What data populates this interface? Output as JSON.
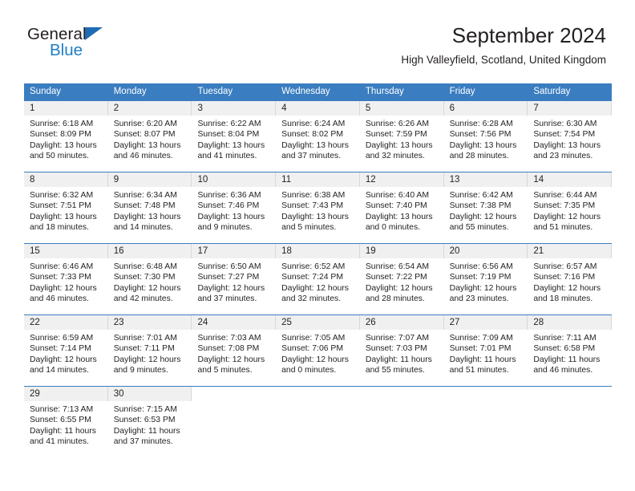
{
  "logo": {
    "word1": "General",
    "word2": "Blue",
    "triangle_color": "#1f6cb4",
    "blue_color": "#1f7ec4"
  },
  "header": {
    "title": "September 2024",
    "subtitle": "High Valleyfield, Scotland, United Kingdom"
  },
  "colors": {
    "header_bar": "#3a7dc0",
    "daynum_band": "#f0f0f0",
    "text": "#231f20"
  },
  "weekdays": [
    "Sunday",
    "Monday",
    "Tuesday",
    "Wednesday",
    "Thursday",
    "Friday",
    "Saturday"
  ],
  "labels": {
    "sunrise": "Sunrise:",
    "sunset": "Sunset:",
    "daylight": "Daylight:"
  },
  "weeks": [
    [
      {
        "day": "1",
        "sunrise": "Sunrise: 6:18 AM",
        "sunset": "Sunset: 8:09 PM",
        "daylight1": "Daylight: 13 hours",
        "daylight2": "and 50 minutes."
      },
      {
        "day": "2",
        "sunrise": "Sunrise: 6:20 AM",
        "sunset": "Sunset: 8:07 PM",
        "daylight1": "Daylight: 13 hours",
        "daylight2": "and 46 minutes."
      },
      {
        "day": "3",
        "sunrise": "Sunrise: 6:22 AM",
        "sunset": "Sunset: 8:04 PM",
        "daylight1": "Daylight: 13 hours",
        "daylight2": "and 41 minutes."
      },
      {
        "day": "4",
        "sunrise": "Sunrise: 6:24 AM",
        "sunset": "Sunset: 8:02 PM",
        "daylight1": "Daylight: 13 hours",
        "daylight2": "and 37 minutes."
      },
      {
        "day": "5",
        "sunrise": "Sunrise: 6:26 AM",
        "sunset": "Sunset: 7:59 PM",
        "daylight1": "Daylight: 13 hours",
        "daylight2": "and 32 minutes."
      },
      {
        "day": "6",
        "sunrise": "Sunrise: 6:28 AM",
        "sunset": "Sunset: 7:56 PM",
        "daylight1": "Daylight: 13 hours",
        "daylight2": "and 28 minutes."
      },
      {
        "day": "7",
        "sunrise": "Sunrise: 6:30 AM",
        "sunset": "Sunset: 7:54 PM",
        "daylight1": "Daylight: 13 hours",
        "daylight2": "and 23 minutes."
      }
    ],
    [
      {
        "day": "8",
        "sunrise": "Sunrise: 6:32 AM",
        "sunset": "Sunset: 7:51 PM",
        "daylight1": "Daylight: 13 hours",
        "daylight2": "and 18 minutes."
      },
      {
        "day": "9",
        "sunrise": "Sunrise: 6:34 AM",
        "sunset": "Sunset: 7:48 PM",
        "daylight1": "Daylight: 13 hours",
        "daylight2": "and 14 minutes."
      },
      {
        "day": "10",
        "sunrise": "Sunrise: 6:36 AM",
        "sunset": "Sunset: 7:46 PM",
        "daylight1": "Daylight: 13 hours",
        "daylight2": "and 9 minutes."
      },
      {
        "day": "11",
        "sunrise": "Sunrise: 6:38 AM",
        "sunset": "Sunset: 7:43 PM",
        "daylight1": "Daylight: 13 hours",
        "daylight2": "and 5 minutes."
      },
      {
        "day": "12",
        "sunrise": "Sunrise: 6:40 AM",
        "sunset": "Sunset: 7:40 PM",
        "daylight1": "Daylight: 13 hours",
        "daylight2": "and 0 minutes."
      },
      {
        "day": "13",
        "sunrise": "Sunrise: 6:42 AM",
        "sunset": "Sunset: 7:38 PM",
        "daylight1": "Daylight: 12 hours",
        "daylight2": "and 55 minutes."
      },
      {
        "day": "14",
        "sunrise": "Sunrise: 6:44 AM",
        "sunset": "Sunset: 7:35 PM",
        "daylight1": "Daylight: 12 hours",
        "daylight2": "and 51 minutes."
      }
    ],
    [
      {
        "day": "15",
        "sunrise": "Sunrise: 6:46 AM",
        "sunset": "Sunset: 7:33 PM",
        "daylight1": "Daylight: 12 hours",
        "daylight2": "and 46 minutes."
      },
      {
        "day": "16",
        "sunrise": "Sunrise: 6:48 AM",
        "sunset": "Sunset: 7:30 PM",
        "daylight1": "Daylight: 12 hours",
        "daylight2": "and 42 minutes."
      },
      {
        "day": "17",
        "sunrise": "Sunrise: 6:50 AM",
        "sunset": "Sunset: 7:27 PM",
        "daylight1": "Daylight: 12 hours",
        "daylight2": "and 37 minutes."
      },
      {
        "day": "18",
        "sunrise": "Sunrise: 6:52 AM",
        "sunset": "Sunset: 7:24 PM",
        "daylight1": "Daylight: 12 hours",
        "daylight2": "and 32 minutes."
      },
      {
        "day": "19",
        "sunrise": "Sunrise: 6:54 AM",
        "sunset": "Sunset: 7:22 PM",
        "daylight1": "Daylight: 12 hours",
        "daylight2": "and 28 minutes."
      },
      {
        "day": "20",
        "sunrise": "Sunrise: 6:56 AM",
        "sunset": "Sunset: 7:19 PM",
        "daylight1": "Daylight: 12 hours",
        "daylight2": "and 23 minutes."
      },
      {
        "day": "21",
        "sunrise": "Sunrise: 6:57 AM",
        "sunset": "Sunset: 7:16 PM",
        "daylight1": "Daylight: 12 hours",
        "daylight2": "and 18 minutes."
      }
    ],
    [
      {
        "day": "22",
        "sunrise": "Sunrise: 6:59 AM",
        "sunset": "Sunset: 7:14 PM",
        "daylight1": "Daylight: 12 hours",
        "daylight2": "and 14 minutes."
      },
      {
        "day": "23",
        "sunrise": "Sunrise: 7:01 AM",
        "sunset": "Sunset: 7:11 PM",
        "daylight1": "Daylight: 12 hours",
        "daylight2": "and 9 minutes."
      },
      {
        "day": "24",
        "sunrise": "Sunrise: 7:03 AM",
        "sunset": "Sunset: 7:08 PM",
        "daylight1": "Daylight: 12 hours",
        "daylight2": "and 5 minutes."
      },
      {
        "day": "25",
        "sunrise": "Sunrise: 7:05 AM",
        "sunset": "Sunset: 7:06 PM",
        "daylight1": "Daylight: 12 hours",
        "daylight2": "and 0 minutes."
      },
      {
        "day": "26",
        "sunrise": "Sunrise: 7:07 AM",
        "sunset": "Sunset: 7:03 PM",
        "daylight1": "Daylight: 11 hours",
        "daylight2": "and 55 minutes."
      },
      {
        "day": "27",
        "sunrise": "Sunrise: 7:09 AM",
        "sunset": "Sunset: 7:01 PM",
        "daylight1": "Daylight: 11 hours",
        "daylight2": "and 51 minutes."
      },
      {
        "day": "28",
        "sunrise": "Sunrise: 7:11 AM",
        "sunset": "Sunset: 6:58 PM",
        "daylight1": "Daylight: 11 hours",
        "daylight2": "and 46 minutes."
      }
    ],
    [
      {
        "day": "29",
        "sunrise": "Sunrise: 7:13 AM",
        "sunset": "Sunset: 6:55 PM",
        "daylight1": "Daylight: 11 hours",
        "daylight2": "and 41 minutes."
      },
      {
        "day": "30",
        "sunrise": "Sunrise: 7:15 AM",
        "sunset": "Sunset: 6:53 PM",
        "daylight1": "Daylight: 11 hours",
        "daylight2": "and 37 minutes."
      },
      {
        "day": "",
        "sunrise": "",
        "sunset": "",
        "daylight1": "",
        "daylight2": ""
      },
      {
        "day": "",
        "sunrise": "",
        "sunset": "",
        "daylight1": "",
        "daylight2": ""
      },
      {
        "day": "",
        "sunrise": "",
        "sunset": "",
        "daylight1": "",
        "daylight2": ""
      },
      {
        "day": "",
        "sunrise": "",
        "sunset": "",
        "daylight1": "",
        "daylight2": ""
      },
      {
        "day": "",
        "sunrise": "",
        "sunset": "",
        "daylight1": "",
        "daylight2": ""
      }
    ]
  ]
}
